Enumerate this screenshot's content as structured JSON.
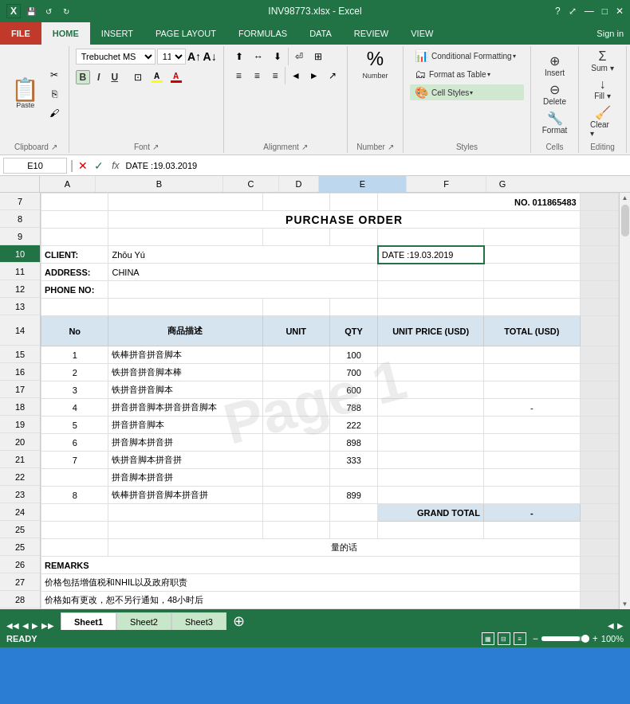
{
  "titleBar": {
    "title": "INV98773.xlsx - Excel",
    "appIcon": "X",
    "qat": [
      "save",
      "undo",
      "redo"
    ],
    "winBtns": [
      "?",
      "⤢",
      "—",
      "□",
      "✕"
    ]
  },
  "ribbon": {
    "tabs": [
      "FILE",
      "HOME",
      "INSERT",
      "PAGE LAYOUT",
      "FORMULAS",
      "DATA",
      "REVIEW",
      "VIEW"
    ],
    "activeTab": "HOME",
    "signIn": "Sign in",
    "groups": {
      "clipboard": {
        "label": "Clipboard",
        "buttons": [
          "Paste",
          "Cut",
          "Copy",
          "Format Painter"
        ]
      },
      "font": {
        "label": "Font",
        "fontName": "Trebuchet MS",
        "fontSize": "11",
        "bold": "B",
        "italic": "I",
        "underline": "U",
        "fontColorLabel": "A",
        "highlightLabel": "A"
      },
      "alignment": {
        "label": "Alignment"
      },
      "number": {
        "label": "Number",
        "format": "%"
      },
      "styles": {
        "label": "Styles",
        "buttons": [
          "Conditional Formatting ▾",
          "Format as Table ▾",
          "Cell Styles ▾"
        ]
      },
      "cells": {
        "label": "Cells"
      },
      "editing": {
        "label": "Editing"
      }
    }
  },
  "formulaBar": {
    "nameBox": "E10",
    "formula": "DATE :19.03.2019"
  },
  "columns": [
    {
      "id": "A",
      "label": "A",
      "width": 70
    },
    {
      "id": "B",
      "label": "B",
      "width": 160
    },
    {
      "id": "C",
      "label": "C",
      "width": 70
    },
    {
      "id": "D",
      "label": "D",
      "width": 50
    },
    {
      "id": "E",
      "label": "E",
      "width": 110
    },
    {
      "id": "F",
      "label": "F",
      "width": 100
    },
    {
      "id": "G",
      "label": "G",
      "width": 40
    }
  ],
  "rows": [
    {
      "num": 7,
      "cells": [
        "",
        "",
        "",
        "",
        "NO. 011865483",
        "",
        ""
      ]
    },
    {
      "num": 8,
      "cells": [
        "",
        "PURCHASE ORDER",
        "",
        "",
        "",
        "",
        ""
      ],
      "mergeCenter": true
    },
    {
      "num": 9,
      "cells": [
        "",
        "",
        "",
        "",
        "",
        "",
        ""
      ]
    },
    {
      "num": 10,
      "cells": [
        "CLIENT:",
        "Zhōu Yú",
        "",
        "",
        "DATE :19.03.2019",
        "",
        ""
      ],
      "activeE": true
    },
    {
      "num": 11,
      "cells": [
        "ADDRESS:",
        "CHINA",
        "",
        "",
        "",
        "",
        ""
      ]
    },
    {
      "num": 12,
      "cells": [
        "PHONE NO:",
        "",
        "",
        "",
        "",
        "",
        ""
      ]
    },
    {
      "num": 13,
      "cells": [
        "",
        "",
        "",
        "",
        "",
        "",
        ""
      ]
    },
    {
      "num": 14,
      "cells": [
        "No",
        "商品描述",
        "UNIT",
        "QTY",
        "UNIT PRICE (USD)",
        "TOTAL  (USD)",
        ""
      ],
      "header": true
    },
    {
      "num": 15,
      "cells": [
        "1",
        "铁棒拼音拼音脚本",
        "",
        "100",
        "",
        "",
        ""
      ]
    },
    {
      "num": 16,
      "cells": [
        "2",
        "铁拼音拼音脚本棒",
        "",
        "700",
        "",
        "",
        ""
      ]
    },
    {
      "num": 17,
      "cells": [
        "3",
        "铁拼音拼音脚本",
        "",
        "600",
        "",
        "",
        ""
      ]
    },
    {
      "num": 18,
      "cells": [
        "4",
        "拼音拼音脚本拼音拼音脚本",
        "",
        "788",
        "",
        "-",
        ""
      ]
    },
    {
      "num": 19,
      "cells": [
        "5",
        "拼音拼音脚本",
        "",
        "222",
        "",
        "",
        ""
      ]
    },
    {
      "num": 20,
      "cells": [
        "6",
        "拼音脚本拼音拼",
        "",
        "898",
        "",
        "",
        ""
      ]
    },
    {
      "num": 21,
      "cells": [
        "7",
        "铁拼音脚本拼音拼",
        "",
        "333",
        "",
        "",
        ""
      ]
    },
    {
      "num": 22,
      "cells": [
        "",
        "拼音脚本拼音拼",
        "",
        "",
        "",
        "",
        ""
      ]
    },
    {
      "num": 23,
      "cells": [
        "8",
        "铁棒拼音拼音脚本拼音拼",
        "",
        "899",
        "",
        "",
        ""
      ]
    },
    {
      "num": 24,
      "cells": [
        "",
        "",
        "",
        "",
        "GRAND TOTAL",
        "-",
        ""
      ],
      "grandTotal": true
    },
    {
      "num": 25,
      "cells": [
        "",
        "",
        "",
        "",
        "",
        "",
        ""
      ]
    },
    {
      "num": 25,
      "cells": [
        "",
        "量的话",
        "",
        "",
        "",
        "",
        ""
      ],
      "centerB": true
    },
    {
      "num": 26,
      "cells": [
        "REMARKS",
        "",
        "",
        "",
        "",
        "",
        ""
      ],
      "boldA": true
    },
    {
      "num": 27,
      "cells": [
        "价格包括增值税和NHIL以及政府职责",
        "",
        "",
        "",
        "",
        "",
        ""
      ]
    },
    {
      "num": 28,
      "cells": [
        "价格如有更改，恕不另行通知，48小时后",
        "",
        "",
        "",
        "",
        "",
        ""
      ]
    }
  ],
  "sheets": [
    "Sheet1",
    "Sheet2",
    "Sheet3"
  ],
  "activeSheet": "Sheet1",
  "status": {
    "ready": "READY",
    "zoom": "100%",
    "scrollNav": [
      "◀",
      "▶"
    ]
  },
  "watermark": "Page 1"
}
